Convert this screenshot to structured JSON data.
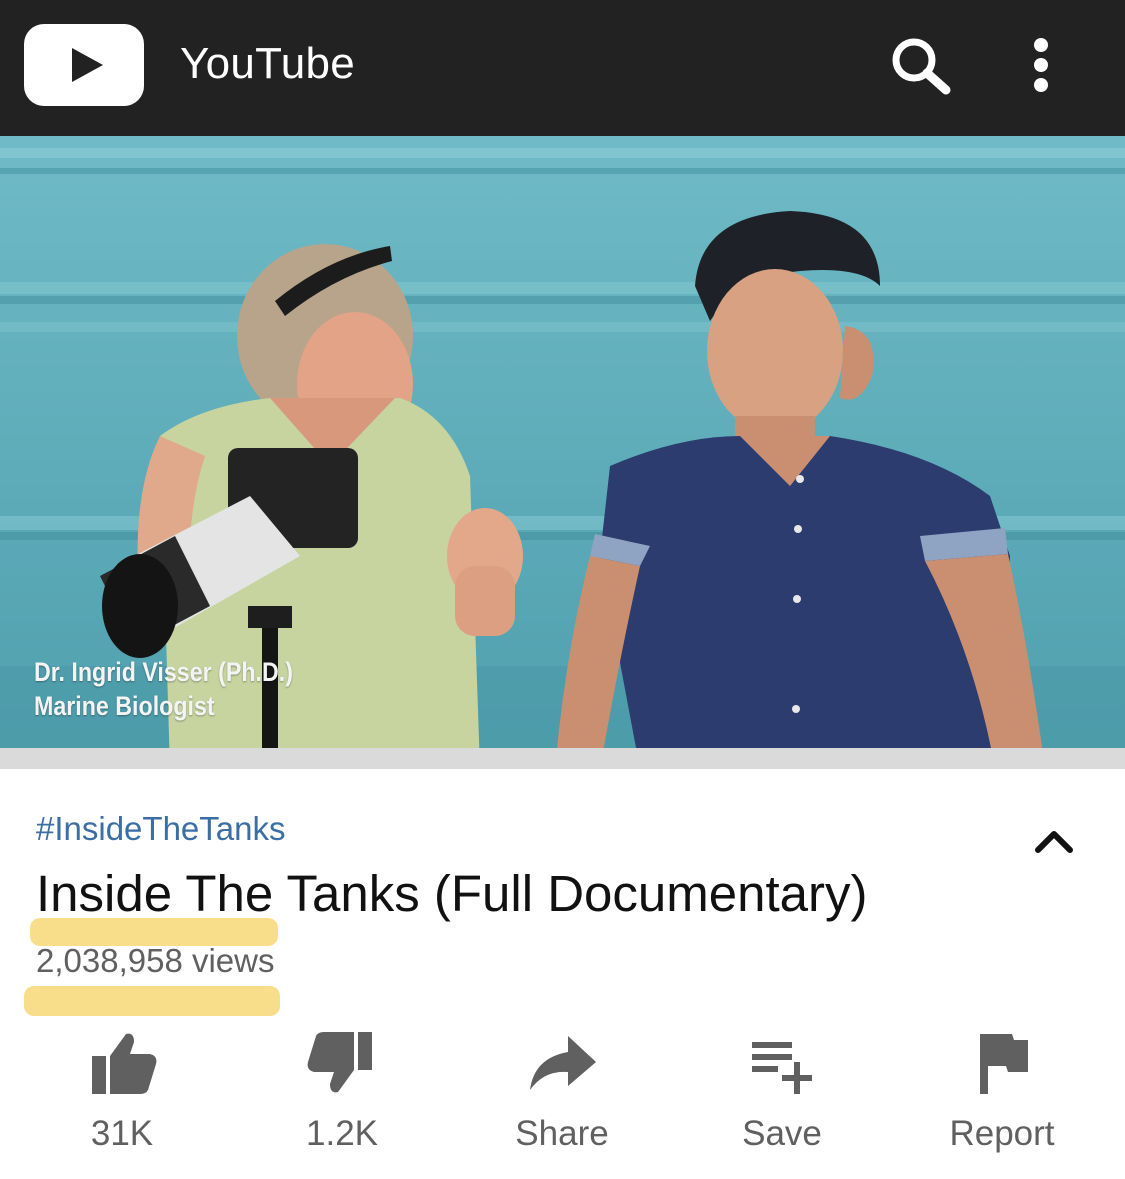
{
  "header": {
    "app_title": "YouTube",
    "logo_icon": "youtube-logo-icon",
    "search_icon": "search-icon",
    "menu_icon": "more-vert-icon",
    "background_color": "#222222"
  },
  "video": {
    "caption_name": "Dr. Ingrid Visser (Ph.D.)",
    "caption_role": "Marine Biologist"
  },
  "details": {
    "hashtag": "#InsideTheTanks",
    "title": "Inside The Tanks (Full Documentary)",
    "views": "2,038,958 views",
    "collapse_icon": "chevron-up-icon",
    "hashtag_color": "#3a6ea5",
    "highlight_color": "#f7d777"
  },
  "actions": {
    "like": {
      "label": "31K",
      "icon": "thumb-up-icon"
    },
    "dislike": {
      "label": "1.2K",
      "icon": "thumb-down-icon"
    },
    "share": {
      "label": "Share",
      "icon": "share-icon"
    },
    "save": {
      "label": "Save",
      "icon": "playlist-add-icon"
    },
    "report": {
      "label": "Report",
      "icon": "flag-icon"
    }
  }
}
